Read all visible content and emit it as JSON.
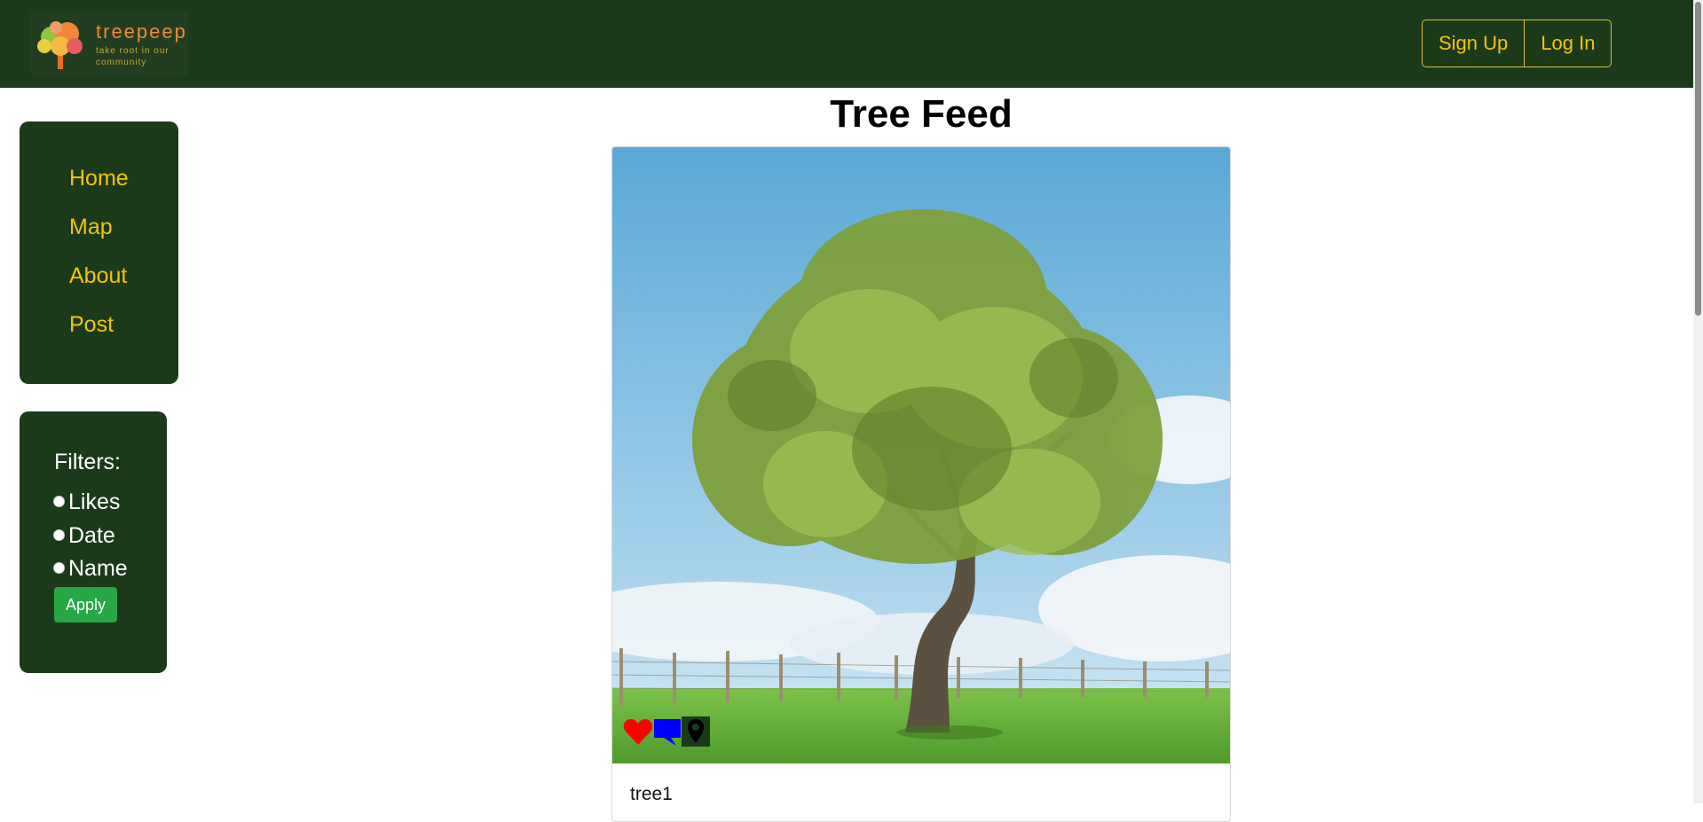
{
  "header": {
    "logo_name": "treepeep",
    "logo_tagline": "take root in our community",
    "signup_label": "Sign Up",
    "login_label": "Log In"
  },
  "nav": {
    "items": [
      {
        "label": "Home"
      },
      {
        "label": "Map"
      },
      {
        "label": "About"
      },
      {
        "label": "Post"
      }
    ]
  },
  "filters": {
    "title": "Filters:",
    "options": [
      {
        "label": "Likes",
        "selected": false
      },
      {
        "label": "Date",
        "selected": false
      },
      {
        "label": "Name",
        "selected": false
      }
    ],
    "apply_label": "Apply"
  },
  "feed": {
    "title": "Tree Feed",
    "posts": [
      {
        "name": "tree1",
        "icons": [
          "heart-icon",
          "comment-icon",
          "location-pin-icon"
        ]
      }
    ]
  },
  "colors": {
    "header_bg": "#1b3a1a",
    "accent": "#f1c40f",
    "apply_button": "#28a745",
    "like": "#ff0000",
    "comment": "#0000ff"
  }
}
